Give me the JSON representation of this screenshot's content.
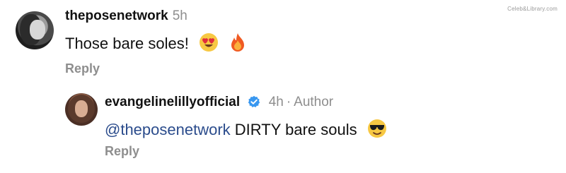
{
  "watermark": "Celeb&Library.com",
  "comments": [
    {
      "username": "theposenetwork",
      "time": "5h",
      "text": "Those bare soles!",
      "emojis": [
        "heart-eyes-emoji",
        "fire-emoji"
      ],
      "reply_label": "Reply"
    },
    {
      "username": "evangelinelillyofficial",
      "verified": true,
      "time": "4h",
      "separator": "·",
      "author_label": "Author",
      "mention": "@theposenetwork",
      "text": "DIRTY bare souls",
      "emojis": [
        "sunglasses-emoji"
      ],
      "reply_label": "Reply"
    }
  ],
  "colors": {
    "verified_blue": "#3897f0",
    "mention_blue": "#2b4c8c",
    "secondary_gray": "#8e8e8e"
  }
}
